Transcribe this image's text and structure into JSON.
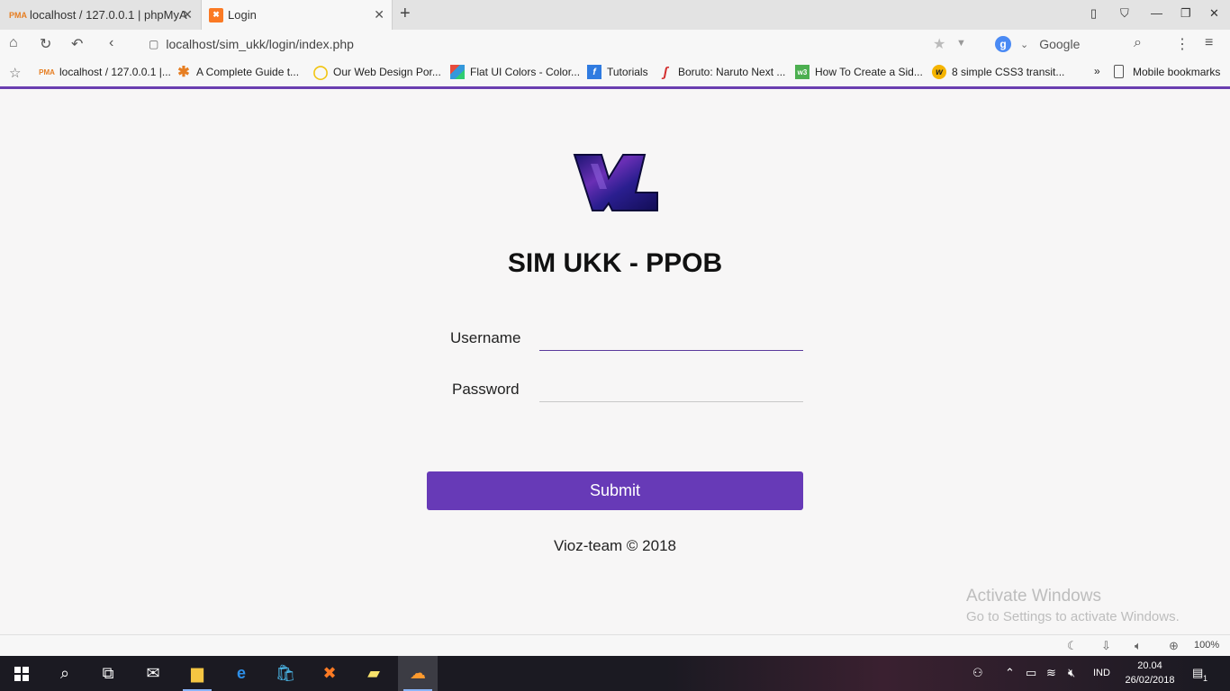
{
  "browser": {
    "tabs": [
      {
        "title": "localhost / 127.0.0.1 | phpMyA",
        "favicon": "phpmyadmin-icon",
        "active": false
      },
      {
        "title": "Login",
        "favicon": "xampp-icon",
        "active": true
      }
    ],
    "address": "localhost/sim_ukk/login/index.php",
    "search_engine": "Google",
    "zoom": "100%"
  },
  "bookmarks": [
    {
      "label": "localhost / 127.0.0.1 |...",
      "icon": "phpmyadmin-icon"
    },
    {
      "label": "A Complete Guide t...",
      "icon": "asterisk-icon"
    },
    {
      "label": "Our Web Design Por...",
      "icon": "circle-icon"
    },
    {
      "label": "Flat UI Colors - Color...",
      "icon": "palette-icon"
    },
    {
      "label": "Tutorials",
      "icon": "f-icon"
    },
    {
      "label": "Boruto: Naruto Next ...",
      "icon": "s-icon"
    },
    {
      "label": "How To Create a Sid...",
      "icon": "w3-icon"
    },
    {
      "label": "8 simple CSS3 transit...",
      "icon": "w-icon"
    }
  ],
  "bookmarks_overflow": "»",
  "mobile_bookmarks": "Mobile bookmarks",
  "login": {
    "title": "SIM UKK - PPOB",
    "username_label": "Username",
    "username_value": "",
    "password_label": "Password",
    "password_value": "",
    "submit_label": "Submit",
    "footer": "Vioz-team © 2018"
  },
  "watermark": {
    "line1": "Activate Windows",
    "line2": "Go to Settings to activate Windows."
  },
  "taskbar": {
    "language": "IND",
    "time": "20.04",
    "date": "26/02/2018",
    "notifications": "1"
  },
  "colors": {
    "accent": "#673ab7",
    "tab_strip": "#e3e3e3",
    "taskbar": "#1b1a22"
  }
}
